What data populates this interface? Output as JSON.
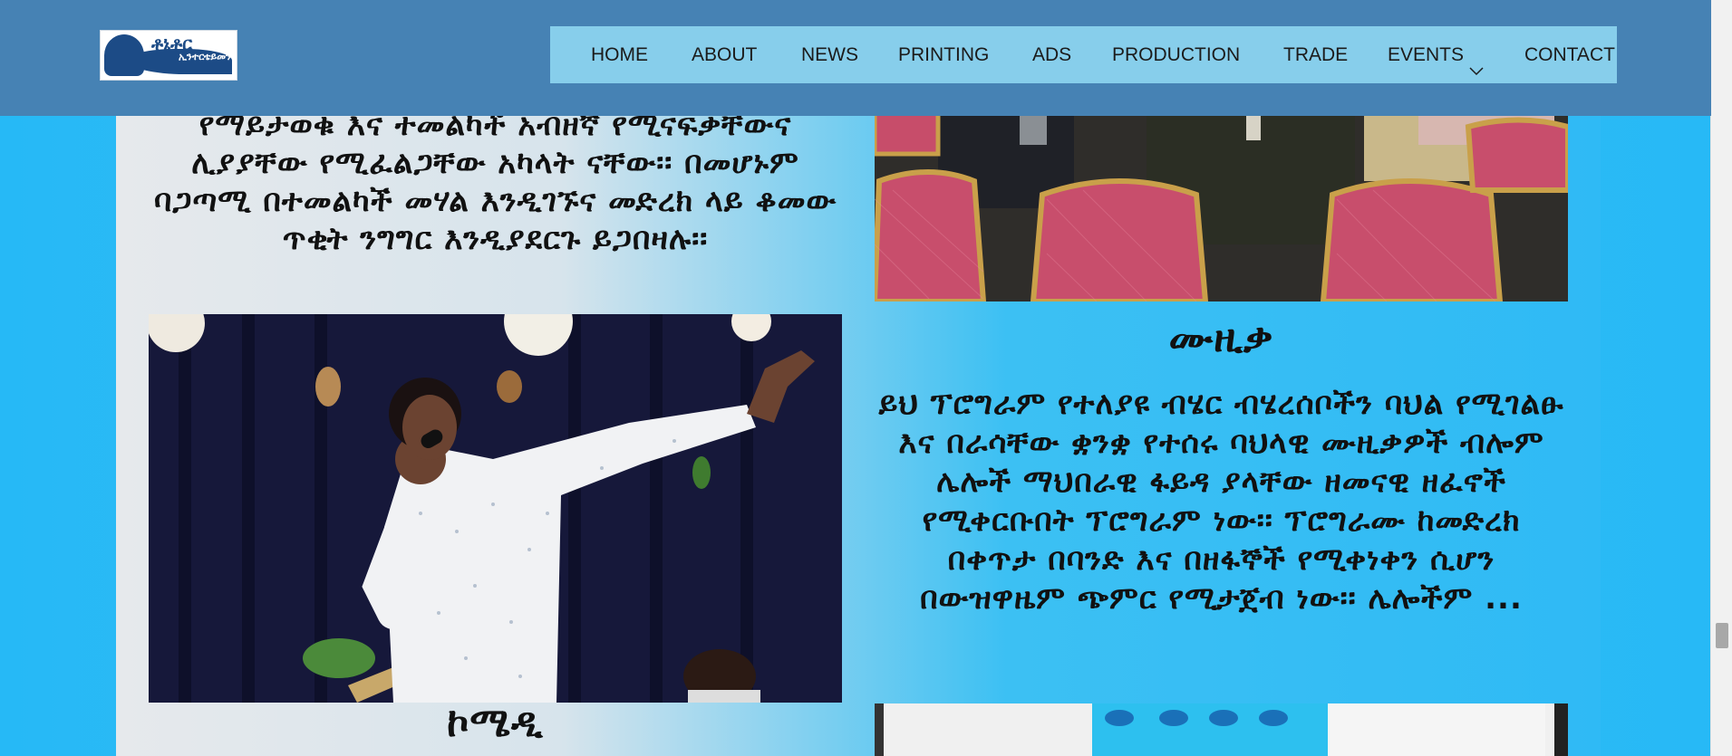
{
  "header": {
    "logo": {
      "line1": "ቶኔቶር",
      "line2": "ኢንተርቴይመንት"
    },
    "nav": [
      {
        "label": "HOME"
      },
      {
        "label": "ABOUT"
      },
      {
        "label": "NEWS"
      },
      {
        "label": "PRINTING"
      },
      {
        "label": "ADS"
      },
      {
        "label": "PRODUCTION"
      },
      {
        "label": "TRADE"
      },
      {
        "label": "EVENTS",
        "icon": "chevron-down-icon"
      },
      {
        "label": "CONTACT"
      }
    ]
  },
  "sections": {
    "top_paragraph": "የማይታወቁ እና ተመልካች አብዘኛ የሚናፍቃቸውና ሊያያቸው የሚፈልጋቸው አካላት ናቸው፡፡ በመሆኑም ባጋጣሚ በተመልካች መሃል እንዲገኙና መድረክ ላይ ቆመው ጥቂት ንግግር እንዲያደርጉ ይጋበዛሉ፡፡",
    "music_title": "ሙዚቃ",
    "music_paragraph": "ይህ ፕሮግራም የተለያዩ ብሄር ብሄረሰቦችን ባህል የሚገልፁ እና በራሳቸው ቋንቋ የተሰሩ ባህላዊ ሙዚቃዎች ብሎም ሌሎች ማህበራዊ ፋይዳ ያላቸው ዘመናዊ ዘፈኖች የሚቀርቡበት ፕሮግራም ነው፡፡ ፕሮግራሙ ከመድረክ በቀጥታ በባንድ እና በዘፋኞች የሚቀነቀን ሲሆን በውዝዋዜም ጭምር የሚታጀብ ነው፡፡ ሌሎችም ...",
    "comedy_title": "ኮሜዲ"
  },
  "colors": {
    "header_bg": "#4682b4",
    "nav_bg": "#87ceeb",
    "page_bg": "#26b9f6"
  }
}
